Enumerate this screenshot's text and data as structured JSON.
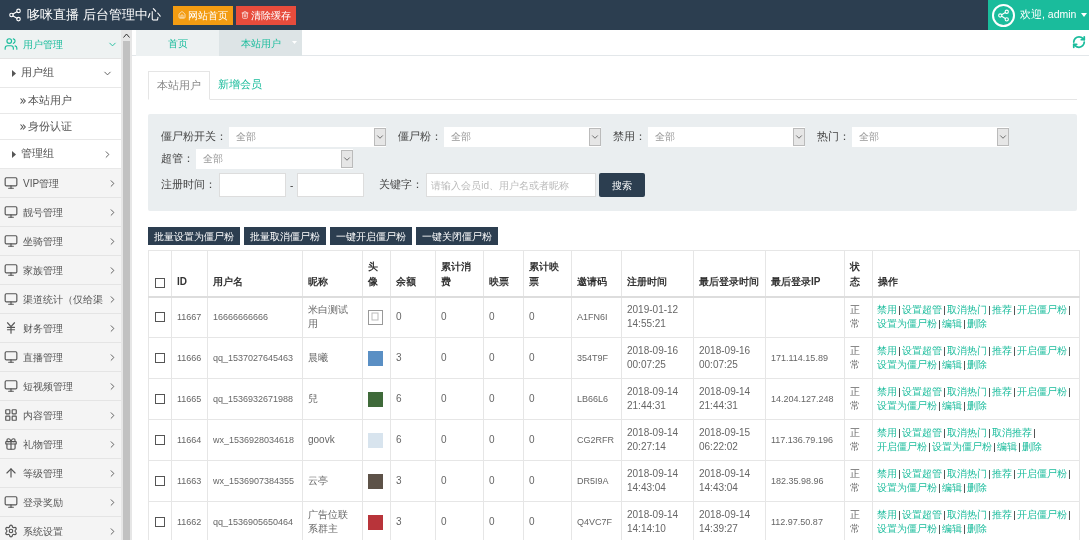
{
  "header": {
    "title": "哆咪直播 后台管理中心",
    "buttons": [
      {
        "label": "网站首页",
        "kind": "home"
      },
      {
        "label": "清除缓存",
        "kind": "clear"
      }
    ],
    "user": "欢迎, admin"
  },
  "sidebar": {
    "items": [
      {
        "label": "用户管理",
        "selected": true,
        "expanded": true,
        "children": [
          {
            "label": "用户组",
            "expanded": true,
            "children": [
              {
                "label": "本站用户"
              },
              {
                "label": "身份认证"
              }
            ]
          },
          {
            "label": "管理组",
            "expanded": false
          }
        ]
      },
      {
        "label": "VIP管理",
        "selected": false,
        "expanded": false
      },
      {
        "label": "靓号管理",
        "selected": false,
        "expanded": false
      },
      {
        "label": "坐骑管理",
        "selected": false,
        "expanded": false
      },
      {
        "label": "家族管理",
        "selected": false,
        "expanded": false
      },
      {
        "label": "渠道统计（仅给渠",
        "selected": false,
        "expanded": false
      },
      {
        "label": "财务管理",
        "selected": false,
        "expanded": false
      },
      {
        "label": "直播管理",
        "selected": false,
        "expanded": false
      },
      {
        "label": "短视频管理",
        "selected": false,
        "expanded": false
      },
      {
        "label": "内容管理",
        "selected": false,
        "expanded": false
      },
      {
        "label": "礼物管理",
        "selected": false,
        "expanded": false
      },
      {
        "label": "等级管理",
        "selected": false,
        "expanded": false
      },
      {
        "label": "登录奖励",
        "selected": false,
        "expanded": false
      },
      {
        "label": "系统设置",
        "selected": false,
        "expanded": false
      }
    ]
  },
  "page_tabs": [
    {
      "label": "首页",
      "selected": false
    },
    {
      "label": "本站用户",
      "selected": true
    }
  ],
  "inner_tabs": [
    {
      "label": "本站用户",
      "selected": true
    },
    {
      "label": "新增会员",
      "selected": false
    }
  ],
  "filters": {
    "selects": [
      {
        "label": "僵尸粉开关：",
        "value": "全部"
      },
      {
        "label": "僵尸粉：",
        "value": "全部"
      },
      {
        "label": "禁用：",
        "value": "全部"
      },
      {
        "label": "热门：",
        "value": "全部"
      },
      {
        "label": "超管：",
        "value": "全部"
      }
    ],
    "date_label": "注册时间：",
    "date_sep": "-",
    "keyword_label": "关键字：",
    "keyword_placeholder": "请输入会员id、用户名或者昵称",
    "search": "搜索"
  },
  "batch_buttons": [
    "批量设置为僵尸粉",
    "批量取消僵尸粉",
    "一键开启僵尸粉",
    "一键关闭僵尸粉"
  ],
  "table": {
    "select_all_checked": false,
    "columns": [
      "ID",
      "用户名",
      "昵称",
      "头像",
      "余额",
      "累计消费",
      "映票",
      "累计映票",
      "邀请码",
      "注册时间",
      "最后登录时间",
      "最后登录IP",
      "状态",
      "操作"
    ],
    "rows": [
      {
        "checked": false,
        "id": "11667",
        "username": "16666666666",
        "nickname": "米白测试用",
        "avatar": {
          "kind": "broken"
        },
        "balance": "0",
        "spent": "0",
        "tickets": "0",
        "total_tickets": "0",
        "code": "A1FN6I",
        "registered": "2019-01-12 14:55:21",
        "last_login": "",
        "last_ip": "",
        "status": "正常",
        "actions": [
          "禁用",
          "设置超管",
          "取消热门",
          "推荐",
          "开启僵尸粉",
          "设置为僵尸粉",
          "编辑",
          "删除"
        ]
      },
      {
        "checked": false,
        "id": "11666",
        "username": "qq_1537027645463",
        "nickname": "晨曦",
        "avatar": {
          "kind": "photo",
          "color": "#5a8fc4"
        },
        "balance": "3",
        "spent": "0",
        "tickets": "0",
        "total_tickets": "0",
        "code": "354T9F",
        "registered": "2018-09-16 00:07:25",
        "last_login": "2018-09-16 00:07:25",
        "last_ip": "171.114.15.89",
        "status": "正常",
        "actions": [
          "禁用",
          "设置超管",
          "取消热门",
          "推荐",
          "开启僵尸粉",
          "设置为僵尸粉",
          "编辑",
          "删除"
        ]
      },
      {
        "checked": false,
        "id": "11665",
        "username": "qq_1536932671988",
        "nickname": "兒",
        "avatar": {
          "kind": "photo",
          "color": "#3f6a3a"
        },
        "balance": "6",
        "spent": "0",
        "tickets": "0",
        "total_tickets": "0",
        "code": "LB66L6",
        "registered": "2018-09-14 21:44:31",
        "last_login": "2018-09-14 21:44:31",
        "last_ip": "14.204.127.248",
        "status": "正常",
        "actions": [
          "禁用",
          "设置超管",
          "取消热门",
          "推荐",
          "开启僵尸粉",
          "设置为僵尸粉",
          "编辑",
          "删除"
        ]
      },
      {
        "checked": false,
        "id": "11664",
        "username": "wx_1536928034618",
        "nickname": "goovk",
        "avatar": {
          "kind": "photo",
          "color": "#d8e4ee"
        },
        "balance": "6",
        "spent": "0",
        "tickets": "0",
        "total_tickets": "0",
        "code": "CG2RFR",
        "registered": "2018-09-14 20:27:14",
        "last_login": "2018-09-15 06:22:02",
        "last_ip": "117.136.79.196",
        "status": "正常",
        "actions": [
          "禁用",
          "设置超管",
          "取消热门",
          "取消推荐",
          "开启僵尸粉",
          "设置为僵尸粉",
          "编辑",
          "删除"
        ]
      },
      {
        "checked": false,
        "id": "11663",
        "username": "wx_1536907384355",
        "nickname": "云亭",
        "avatar": {
          "kind": "photo",
          "color": "#5d5248"
        },
        "balance": "3",
        "spent": "0",
        "tickets": "0",
        "total_tickets": "0",
        "code": "DR5I9A",
        "registered": "2018-09-14 14:43:04",
        "last_login": "2018-09-14 14:43:04",
        "last_ip": "182.35.98.96",
        "status": "正常",
        "actions": [
          "禁用",
          "设置超管",
          "取消热门",
          "推荐",
          "开启僵尸粉",
          "设置为僵尸粉",
          "编辑",
          "删除"
        ]
      },
      {
        "checked": false,
        "id": "11662",
        "username": "qq_1536905650464",
        "nickname": "广告位联系群主",
        "avatar": {
          "kind": "photo",
          "color": "#b8343a"
        },
        "balance": "3",
        "spent": "0",
        "tickets": "0",
        "total_tickets": "0",
        "code": "Q4VC7F",
        "registered": "2018-09-14 14:14:10",
        "last_login": "2018-09-14 14:39:27",
        "last_ip": "112.97.50.87",
        "status": "正常",
        "actions": [
          "禁用",
          "设置超管",
          "取消热门",
          "推荐",
          "开启僵尸粉",
          "设置为僵尸粉",
          "编辑",
          "删除"
        ]
      }
    ]
  }
}
